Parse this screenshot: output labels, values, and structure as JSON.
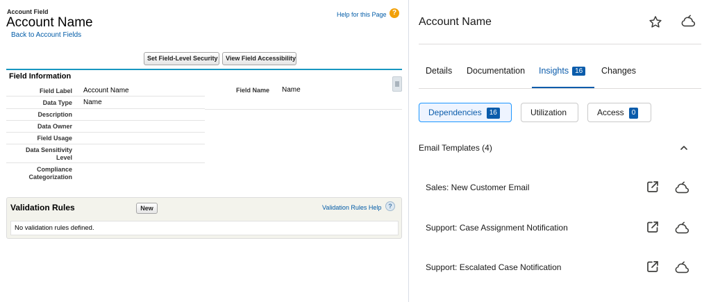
{
  "left": {
    "breadcrumb": "Account Field",
    "title": "Account Name",
    "back_link": "Back to Account Fields",
    "help_link": "Help for this Page",
    "help_icon": "?",
    "buttons": {
      "field_level_security": "Set Field-Level Security",
      "view_accessibility": "View Field Accessibility"
    },
    "field_information": {
      "title": "Field Information",
      "rows": [
        {
          "label": "Field Label",
          "value": "Account Name"
        },
        {
          "label": "Data Type",
          "value": "Name"
        },
        {
          "label": "Description",
          "value": ""
        },
        {
          "label": "Data Owner",
          "value": ""
        },
        {
          "label": "Field Usage",
          "value": ""
        },
        {
          "label": "Data Sensitivity Level",
          "value": ""
        },
        {
          "label": "Compliance Categorization",
          "value": ""
        }
      ],
      "field_name_label": "Field Name",
      "field_name_value": "Name"
    },
    "validation_rules": {
      "title": "Validation Rules",
      "new_button": "New",
      "help_link": "Validation Rules Help",
      "help_icon": "?",
      "empty_message": "No validation rules defined."
    }
  },
  "right": {
    "title": "Account Name",
    "icons": [
      "star-icon",
      "cloud-icon"
    ],
    "tabs": [
      {
        "label": "Details"
      },
      {
        "label": "Documentation"
      },
      {
        "label": "Insights",
        "badge": "16",
        "active": true
      },
      {
        "label": "Changes"
      }
    ],
    "pills": [
      {
        "label": "Dependencies",
        "badge": "16",
        "active": true
      },
      {
        "label": "Utilization"
      },
      {
        "label": "Access",
        "badge": "0"
      }
    ],
    "section": {
      "title": "Email Templates (4)",
      "items": [
        {
          "label": "Sales: New Customer Email"
        },
        {
          "label": "Support: Case Assignment Notification"
        },
        {
          "label": "Support: Escalated Case Notification"
        }
      ]
    },
    "accent_color": "#0b5cab"
  }
}
